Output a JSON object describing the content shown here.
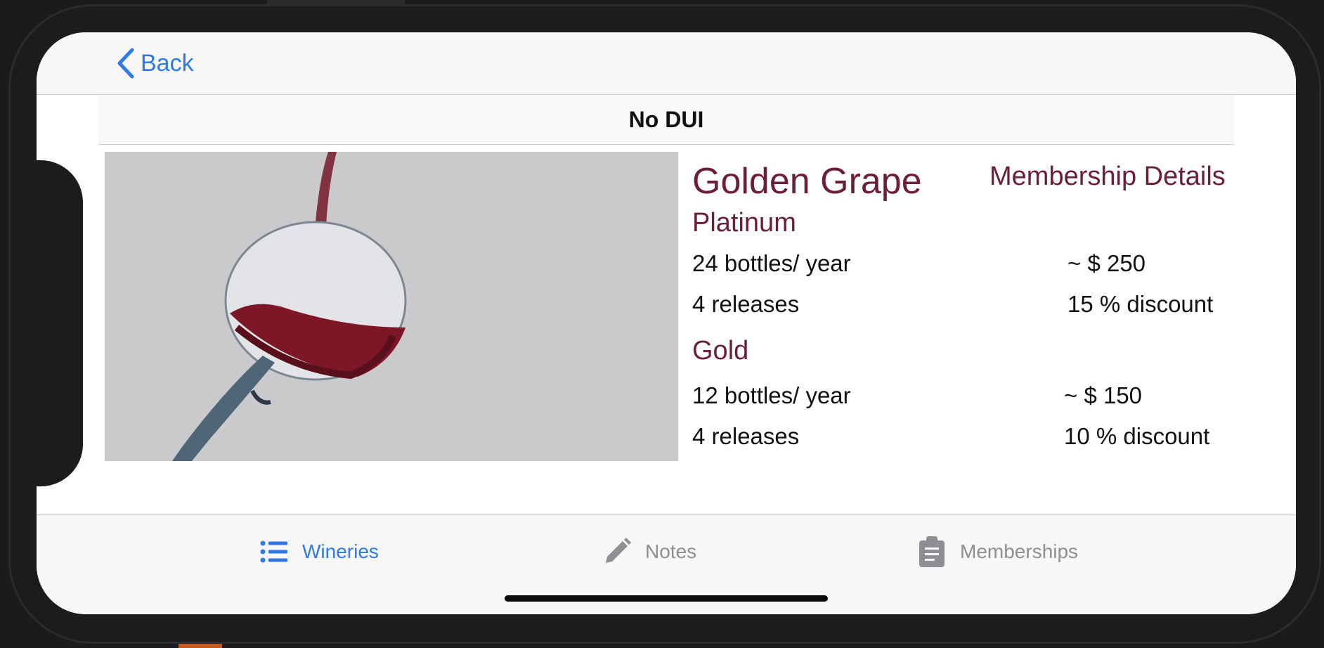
{
  "nav": {
    "back_label": "Back"
  },
  "header": {
    "title": "No DUI"
  },
  "winery": {
    "name": "Golden Grape",
    "details_link": "Membership Details",
    "tiers": [
      {
        "name": "Platinum",
        "bottles": "24 bottles/ year",
        "price": "~ $ 250",
        "releases": "4 releases",
        "discount": "15 % discount"
      },
      {
        "name": "Gold",
        "bottles": "12 bottles/ year",
        "price": "~ $ 150",
        "releases": "4 releases",
        "discount": "10 % discount"
      }
    ]
  },
  "tabs": [
    {
      "label": "Wineries",
      "icon": "list-icon",
      "active": true
    },
    {
      "label": "Notes",
      "icon": "pencil-icon",
      "active": false
    },
    {
      "label": "Memberships",
      "icon": "clipboard-icon",
      "active": false
    }
  ],
  "colors": {
    "accent": "#2f7ae5",
    "wine": "#6b1d3a",
    "inactive": "#8e8e93"
  }
}
